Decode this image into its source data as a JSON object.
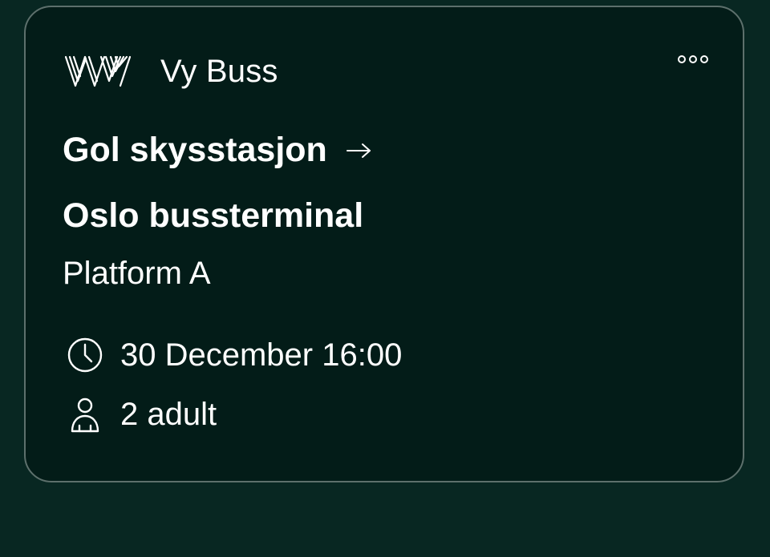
{
  "card": {
    "operator_name": "Vy Buss",
    "logo_icon": "vy-logo-icon",
    "more_icon": "more-options-icon",
    "from_stop": "Gol skysstasjon",
    "to_stop": "Oslo bussterminal",
    "platform": "Platform A",
    "departure": "30 December 16:00",
    "passengers": "2 adult"
  },
  "colors": {
    "background": "#082722",
    "card_background": "#031c18",
    "card_border": "#5d706c",
    "text": "#ffffff"
  }
}
